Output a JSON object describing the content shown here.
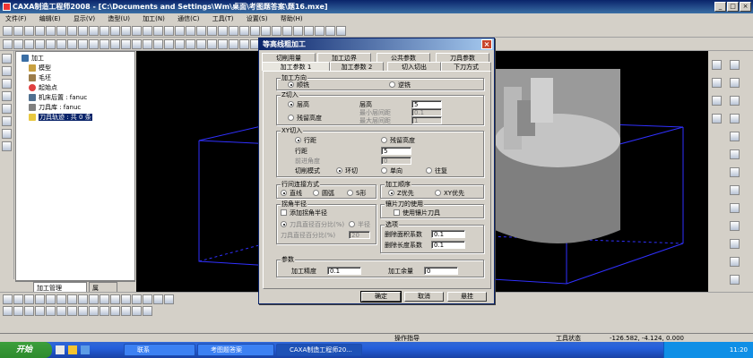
{
  "app": {
    "title": "CAXA制造工程师2008 - [C:\\Documents and Settings\\Wm\\桌面\\考图题答案\\题16.mxe]"
  },
  "menu": [
    "文件(F)",
    "编辑(E)",
    "显示(V)",
    "造型(U)",
    "加工(N)",
    "通信(C)",
    "工具(T)",
    "设置(S)",
    "帮助(H)"
  ],
  "tree": {
    "items": [
      {
        "label": "加工",
        "level": 0
      },
      {
        "label": "模型",
        "level": 1
      },
      {
        "label": "毛坯",
        "level": 1
      },
      {
        "label": "起始点",
        "level": 1
      },
      {
        "label": "机床后置 : fanuc",
        "level": 1
      },
      {
        "label": "刀具库 : fanuc",
        "level": 1
      },
      {
        "label": "刀具轨迹 : 共 0 条",
        "level": 1,
        "selected": true
      }
    ],
    "tabs": [
      "加工管理",
      "属"
    ]
  },
  "dialog": {
    "title": "等高线粗加工",
    "close": "×",
    "tabs_row1": [
      "切削用量",
      "加工边界",
      "公共参数",
      "刀具参数"
    ],
    "tabs_row2": [
      "加工参数 1",
      "加工参数 2",
      "切入切出",
      "下刀方式"
    ],
    "direction": {
      "label": "加工方向",
      "opt1": "顺铣",
      "opt2": "逆铣"
    },
    "z_cut": {
      "label": "Z切入",
      "opt_layer_height": "层高",
      "opt_residual": "残留高度",
      "layer_height_label": "层高",
      "layer_height_value": "5",
      "min_layer_label": "最小层间距",
      "min_layer_value": "0.1",
      "max_layer_label": "最大层间距",
      "max_layer_value": "1"
    },
    "xy_cut": {
      "label": "XY切入",
      "opt_row_spacing": "行距",
      "opt_residual": "残留高度",
      "row_spacing_label": "行距",
      "row_spacing_value": "5",
      "front_angle_label": "前进角度",
      "front_angle_value": "0",
      "cut_mode_label": "切削模式",
      "mode_ring": "环切",
      "mode_single": "单向",
      "mode_back": "往复"
    },
    "row_connect": {
      "label": "行间连接方式",
      "opt1": "直线",
      "opt2": "圆弧",
      "opt3": "S形"
    },
    "order": {
      "label": "加工顺序",
      "opt1": "Z优先",
      "opt2": "XY优先"
    },
    "corner": {
      "label": "拐角半径",
      "add_radius": "添加拐角半径",
      "opt_percent": "刀具直径百分比(%)",
      "opt_radius": "半径",
      "percent_label": "刀具直径百分比(%)",
      "percent_value": "20"
    },
    "insert": {
      "label": "镶片刀的使用",
      "use": "使用镶片刀具"
    },
    "options": {
      "label": "选项",
      "min_area_label": "删除面积系数",
      "min_area_value": "0.1",
      "min_length_label": "删除长度系数",
      "min_length_value": "0.1"
    },
    "params": {
      "label": "参数",
      "precision_label": "加工精度",
      "precision_value": "0.1",
      "allowance_label": "加工余量",
      "allowance_value": "0"
    },
    "buttons": {
      "ok": "确定",
      "cancel": "取消",
      "hang": "悬挂"
    }
  },
  "status": {
    "hint": "操作指导",
    "tool_state": "工具状态",
    "coords": "-126.582, -4.124, 0.000"
  },
  "taskbar": {
    "start": "开始",
    "tasks": [
      "联系",
      "考图题答案",
      "CAXA制造工程师20..."
    ],
    "clock": "11:20"
  }
}
